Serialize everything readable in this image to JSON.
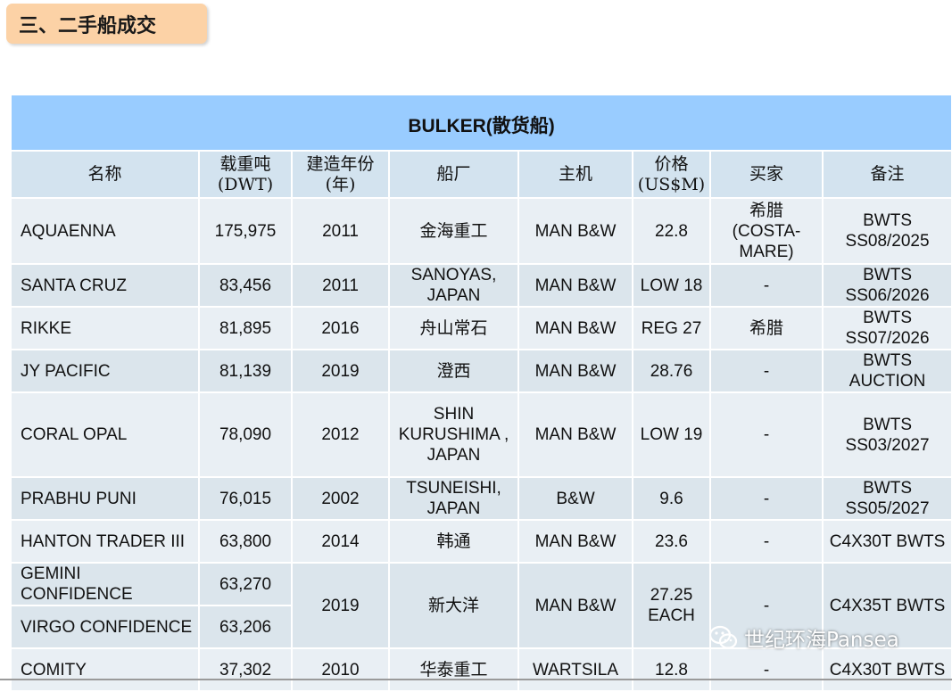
{
  "section_title": "三、二手船成交",
  "table_title": "BULKER(散货船)",
  "headers": {
    "name": "名称",
    "dwt_1": "载重吨",
    "dwt_2": "(DWT)",
    "year_1": "建造年份",
    "year_2": "(年)",
    "yard": "船厂",
    "engine": "主机",
    "price_1": "价格",
    "price_2": "(US$M)",
    "buyer": "买家",
    "remarks": "备注"
  },
  "rows": [
    {
      "name": "AQUAENNA",
      "dwt": "175,975",
      "year": "2011",
      "yard": "金海重工",
      "engine": "MAN B&W",
      "price": "22.8",
      "buyer": "希腊 (COSTA- MARE)",
      "remarks": "BWTS SS08/2025"
    },
    {
      "name": "SANTA CRUZ",
      "dwt": "83,456",
      "year": "2011",
      "yard": "SANOYAS, JAPAN",
      "engine": "MAN B&W",
      "price": "LOW 18",
      "buyer": "-",
      "remarks": "BWTS SS06/2026"
    },
    {
      "name": "RIKKE",
      "dwt": "81,895",
      "year": "2016",
      "yard": "舟山常石",
      "engine": "MAN B&W",
      "price": "REG 27",
      "buyer": "希腊",
      "remarks": "BWTS SS07/2026"
    },
    {
      "name": "JY PACIFIC",
      "dwt": "81,139",
      "year": "2019",
      "yard": "澄西",
      "engine": "MAN B&W",
      "price": "28.76",
      "buyer": "-",
      "remarks": "BWTS AUCTION"
    },
    {
      "name": "CORAL OPAL",
      "dwt": "78,090",
      "year": "2012",
      "yard": "SHIN KURUSHIMA , JAPAN",
      "engine": "MAN B&W",
      "price": "LOW 19",
      "buyer": "-",
      "remarks": "BWTS SS03/2027"
    },
    {
      "name": "PRABHU PUNI",
      "dwt": "76,015",
      "year": "2002",
      "yard": "TSUNEISHI, JAPAN",
      "engine": "B&W",
      "price": "9.6",
      "buyer": "-",
      "remarks": "BWTS SS05/2027"
    },
    {
      "name": "HANTON TRADER III",
      "dwt": "63,800",
      "year": "2014",
      "yard": "韩通",
      "engine": "MAN B&W",
      "price": "23.6",
      "buyer": "-",
      "remarks": "C4X30T BWTS"
    },
    {
      "name": "GEMINI CONFIDENCE",
      "dwt": "63,270"
    },
    {
      "name": "VIRGO CONFIDENCE",
      "dwt": "63,206"
    },
    {
      "name": "COMITY",
      "dwt": "37,302",
      "year": "2010",
      "yard": "华泰重工",
      "engine": "WARTSILA",
      "price": "12.8",
      "buyer": "-",
      "remarks": "C4X30T BWTS"
    }
  ],
  "merged_group": {
    "year": "2019",
    "yard": "新大洋",
    "engine": "MAN B&W",
    "price": "27.25 EACH",
    "buyer": "-",
    "remarks": "C4X35T BWTS"
  },
  "watermark": "世纪环海Pansea",
  "colors": {
    "title_bar": "#99ccff",
    "header_bg": "#d3e3ef",
    "row_dark": "#dbe5ec",
    "row_light": "#e9eff4",
    "section_tag": "#fcd2a6"
  }
}
